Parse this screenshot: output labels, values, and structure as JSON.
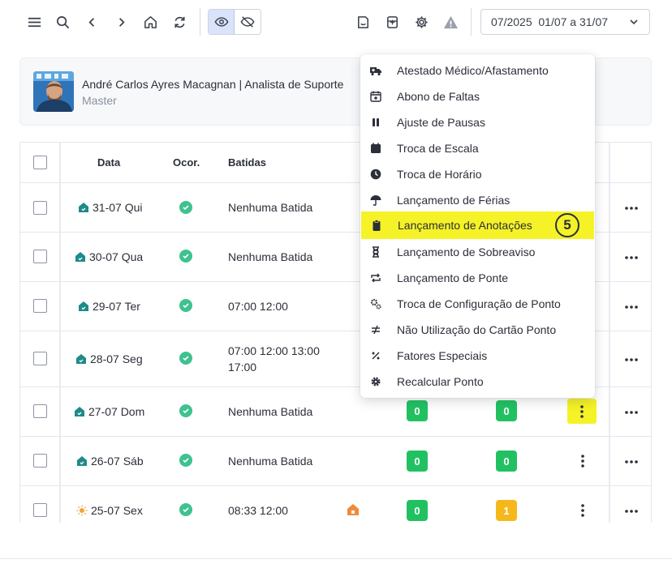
{
  "toolbar": {
    "period_label": "07/2025  01/07 a 31/07"
  },
  "user": {
    "name": "André Carlos Ayres Macagnan | Analista de Suporte",
    "role": "Master"
  },
  "table": {
    "headers": {
      "data": "Data",
      "ocor": "Ocor.",
      "batidas": "Batidas"
    },
    "rows": [
      {
        "date": "31-07 Qui",
        "batidas": [
          "Nenhuma Batida"
        ],
        "icon": "house-icon"
      },
      {
        "date": "30-07 Qua",
        "batidas": [
          "Nenhuma Batida"
        ],
        "icon": "house-icon"
      },
      {
        "date": "29-07 Ter",
        "batidas": [
          "07:00 12:00"
        ],
        "icon": "house-icon"
      },
      {
        "date": "28-07 Seg",
        "batidas": [
          "07:00 12:00 13:00",
          "17:00"
        ],
        "icon": "house-icon"
      },
      {
        "date": "27-07 Dom",
        "batidas": [
          "Nenhuma Batida"
        ],
        "icon": "house-icon",
        "count_a": "0",
        "count_b": "0"
      },
      {
        "date": "26-07 Sáb",
        "batidas": [
          "Nenhuma Batida"
        ],
        "icon": "house-icon",
        "count_a": "0",
        "count_b": "0"
      },
      {
        "date": "25-07 Sex",
        "batidas": [
          "08:33 12:00"
        ],
        "icon": "sun-icon",
        "count_a": "0",
        "count_b": "1"
      }
    ]
  },
  "menu": {
    "items": [
      {
        "label": "Atestado Médico/Afastamento",
        "icon": "ambulance-icon"
      },
      {
        "label": "Abono de Faltas",
        "icon": "calendar-plus-icon"
      },
      {
        "label": "Ajuste de Pausas",
        "icon": "pause-icon"
      },
      {
        "label": "Troca de Escala",
        "icon": "calendar-icon"
      },
      {
        "label": "Troca de Horário",
        "icon": "clock-icon"
      },
      {
        "label": "Lançamento de Férias",
        "icon": "umbrella-icon"
      },
      {
        "label": "Lançamento de Anotações",
        "icon": "clipboard-icon"
      },
      {
        "label": "Lançamento de Sobreaviso",
        "icon": "hourglass-icon"
      },
      {
        "label": "Lançamento de Ponte",
        "icon": "repeat-icon"
      },
      {
        "label": "Troca de Configuração de Ponto",
        "icon": "cogs-icon"
      },
      {
        "label": "Não Utilização do Cartão Ponto",
        "icon": "not-equal-icon"
      },
      {
        "label": "Fatores Especiais",
        "icon": "percent-icon"
      },
      {
        "label": "Recalcular Ponto",
        "icon": "gear-icon"
      }
    ],
    "highlight_index": 6,
    "step_number": "5"
  },
  "colors": {
    "highlight": "#f5f227",
    "success": "#21c162",
    "warning": "#f4b81a",
    "teal_icon": "#1f8a8a"
  }
}
